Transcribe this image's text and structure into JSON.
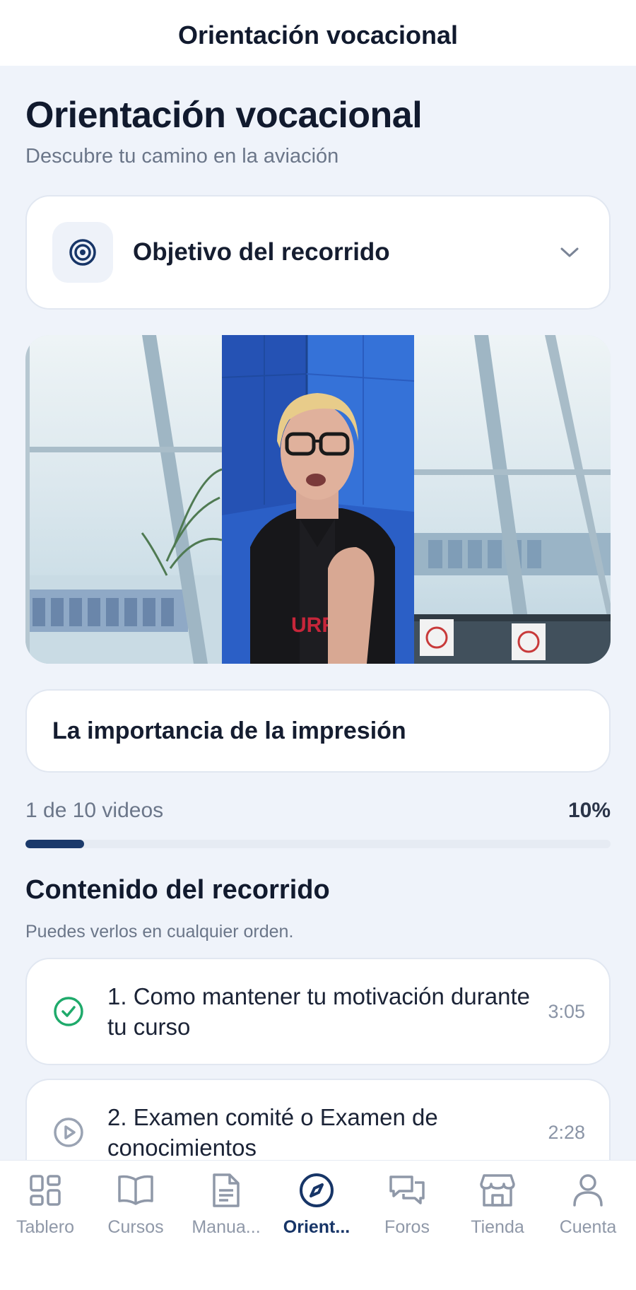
{
  "navbar": {
    "title": "Orientación vocacional"
  },
  "page": {
    "title": "Orientación vocacional",
    "subtitle": "Descubre tu camino en la aviación"
  },
  "objective": {
    "label": "Objetivo del recorrido",
    "icon": "target-icon",
    "expanded": false
  },
  "video": {
    "current_title": "La importancia de la impresión"
  },
  "progress": {
    "count_label": "1 de 10 videos",
    "percent_label": "10%",
    "fraction": 0.1
  },
  "contents": {
    "title": "Contenido del recorrido",
    "subtitle": "Puedes verlos en cualquier orden.",
    "items": [
      {
        "title": "1. Como mantener tu motivación durante tu curso",
        "duration": "3:05",
        "status": "completed"
      },
      {
        "title": "2. Examen comité o Examen de conocimientos",
        "duration": "2:28",
        "status": "play"
      }
    ]
  },
  "tabs": [
    {
      "label": "Tablero",
      "icon": "grid-icon",
      "active": false
    },
    {
      "label": "Cursos",
      "icon": "book-icon",
      "active": false
    },
    {
      "label": "Manua...",
      "icon": "document-icon",
      "active": false
    },
    {
      "label": "Orient...",
      "icon": "compass-icon",
      "active": true
    },
    {
      "label": "Foros",
      "icon": "chat-bubbles-icon",
      "active": false
    },
    {
      "label": "Tienda",
      "icon": "store-icon",
      "active": false
    },
    {
      "label": "Cuenta",
      "icon": "user-icon",
      "active": false
    }
  ],
  "colors": {
    "accent": "#173567",
    "background": "#eff3fa",
    "completed_green": "#1faa6b",
    "inactive_gray": "#8f98a8"
  }
}
